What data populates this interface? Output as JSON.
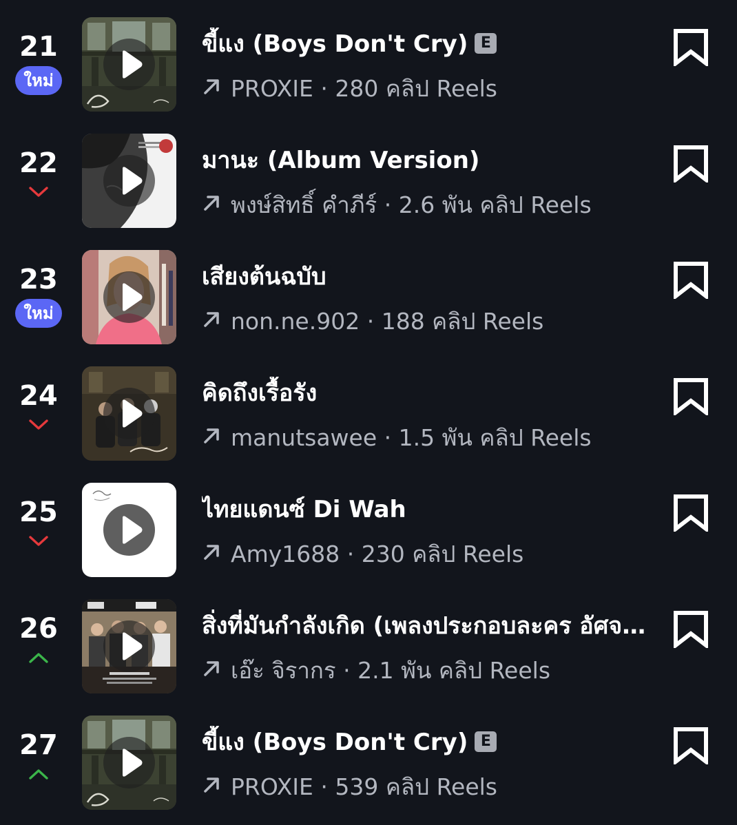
{
  "badge_new_label": "ใหม่",
  "explicit_label": "E",
  "colors": {
    "background": "#12151c",
    "new_badge": "#5b67f5",
    "trend_up": "#3bb54a",
    "trend_down": "#e5393c",
    "meta_text": "#b3b7c0"
  },
  "tracks": [
    {
      "rank": "21",
      "trend": "new",
      "title": "ขี้แง (Boys Don't Cry)",
      "explicit": true,
      "artist": "PROXIE",
      "reels": "280 คลิป Reels",
      "thumb": "church"
    },
    {
      "rank": "22",
      "trend": "down",
      "title": "มานะ (Album Version)",
      "explicit": false,
      "artist": "พงษ์สิทธิ์ คำภีร์",
      "reels": "2.6 พัน คลิป Reels",
      "thumb": "portrait"
    },
    {
      "rank": "23",
      "trend": "new",
      "title": "เสียงต้นฉบับ",
      "explicit": false,
      "artist": "non.ne.902",
      "reels": "188 คลิป Reels",
      "thumb": "selfie"
    },
    {
      "rank": "24",
      "trend": "down",
      "title": "คิดถึงเรื้อรัง",
      "explicit": false,
      "artist": "manutsawee",
      "reels": "1.5 พัน คลิป Reels",
      "thumb": "band"
    },
    {
      "rank": "25",
      "trend": "down",
      "title": "ไทยแดนซ์ Di Wah",
      "explicit": false,
      "artist": "Amy1688",
      "reels": "230 คลิป Reels",
      "thumb": "white"
    },
    {
      "rank": "26",
      "trend": "up",
      "title": "สิ่งที่มันกำลังเกิด (เพลงประกอบละคร อัศจรรย์รักเดลิเวอรี่)",
      "explicit": false,
      "artist": "เอ๊ะ จิรากร",
      "reels": "2.1 พัน คลิป Reels",
      "thumb": "pause"
    },
    {
      "rank": "27",
      "trend": "up",
      "title": "ขี้แง (Boys Don't Cry)",
      "explicit": true,
      "artist": "PROXIE",
      "reels": "539 คลิป Reels",
      "thumb": "church"
    }
  ]
}
